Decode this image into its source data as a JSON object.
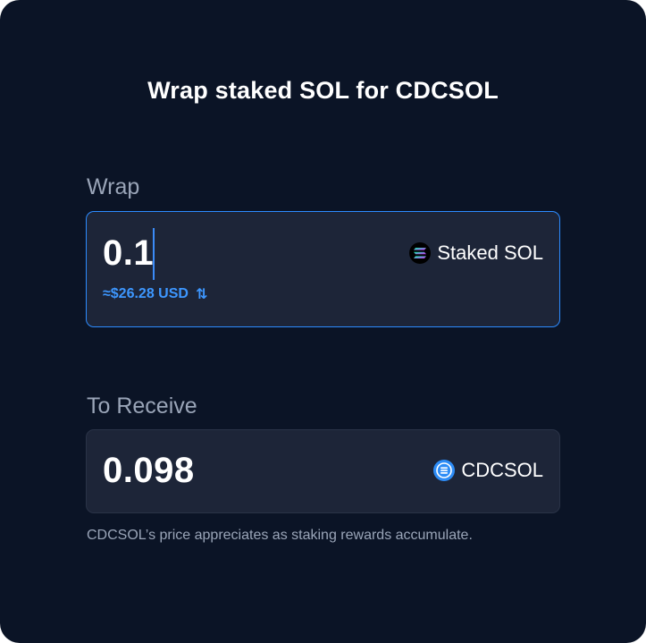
{
  "title": "Wrap staked SOL for CDCSOL",
  "wrap": {
    "label": "Wrap",
    "amount": "0.1",
    "usd_value": "≈$26.28 USD",
    "swap_icon": "⇅",
    "token_name": "Staked SOL",
    "token_icon": "solana-icon"
  },
  "receive": {
    "label": "To Receive",
    "amount": "0.098",
    "token_name": "CDCSOL",
    "token_icon": "cdcsol-icon"
  },
  "note": "CDCSOL’s price appreciates as staking rewards accumulate.",
  "colors": {
    "background": "#0b1426",
    "field": "#1d2538",
    "accent": "#2c8bff",
    "muted_text": "#9aa5b8"
  }
}
